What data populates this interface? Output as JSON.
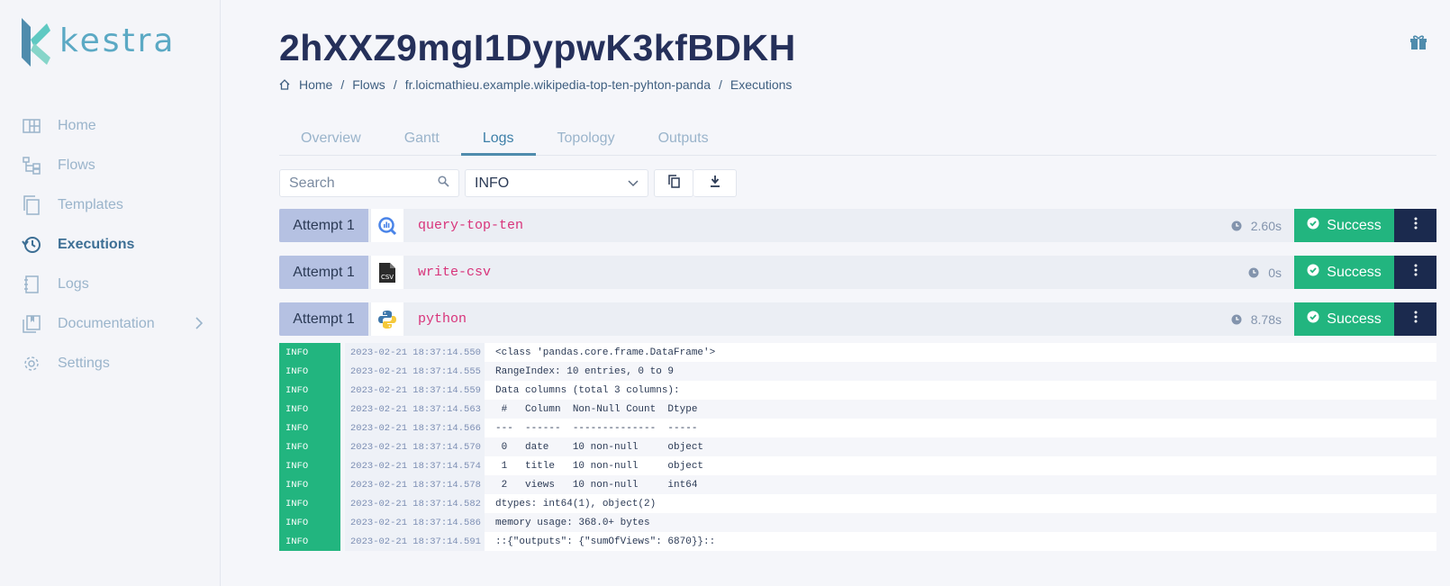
{
  "app": {
    "logo_text": "kestra"
  },
  "sidebar": {
    "items": [
      {
        "label": "Home",
        "icon": "home-grid-icon"
      },
      {
        "label": "Flows",
        "icon": "flows-tree-icon"
      },
      {
        "label": "Templates",
        "icon": "templates-copy-icon"
      },
      {
        "label": "Executions",
        "icon": "history-clock-icon",
        "active": true
      },
      {
        "label": "Logs",
        "icon": "notebook-icon"
      },
      {
        "label": "Documentation",
        "icon": "book-icon",
        "has_children": true
      },
      {
        "label": "Settings",
        "icon": "gear-icon"
      }
    ]
  },
  "header": {
    "title": "2hXXZ9mgI1DypwK3kfBDKH",
    "breadcrumb": [
      "Home",
      "Flows",
      "fr.loicmathieu.example.wikipedia-top-ten-pyhton-panda",
      "Executions"
    ]
  },
  "tabs": [
    "Overview",
    "Gantt",
    "Logs",
    "Topology",
    "Outputs"
  ],
  "active_tab": "Logs",
  "toolbar": {
    "search_placeholder": "Search",
    "level_value": "INFO"
  },
  "attempts": [
    {
      "label": "Attempt 1",
      "task": "query-top-ten",
      "duration": "2.60s",
      "status": "Success",
      "icon": "bigquery-icon"
    },
    {
      "label": "Attempt 1",
      "task": "write-csv",
      "duration": "0s",
      "status": "Success",
      "icon": "csv-file-icon"
    },
    {
      "label": "Attempt 1",
      "task": "python",
      "duration": "8.78s",
      "status": "Success",
      "icon": "python-icon"
    }
  ],
  "logs": [
    {
      "level": "INFO",
      "date": "2023-02-21 18:37:14.550",
      "message": "<class 'pandas.core.frame.DataFrame'>"
    },
    {
      "level": "INFO",
      "date": "2023-02-21 18:37:14.555",
      "message": "RangeIndex: 10 entries, 0 to 9"
    },
    {
      "level": "INFO",
      "date": "2023-02-21 18:37:14.559",
      "message": "Data columns (total 3 columns):"
    },
    {
      "level": "INFO",
      "date": "2023-02-21 18:37:14.563",
      "message": " #   Column  Non-Null Count  Dtype "
    },
    {
      "level": "INFO",
      "date": "2023-02-21 18:37:14.566",
      "message": "---  ------  --------------  ----- "
    },
    {
      "level": "INFO",
      "date": "2023-02-21 18:37:14.570",
      "message": " 0   date    10 non-null     object"
    },
    {
      "level": "INFO",
      "date": "2023-02-21 18:37:14.574",
      "message": " 1   title   10 non-null     object"
    },
    {
      "level": "INFO",
      "date": "2023-02-21 18:37:14.578",
      "message": " 2   views   10 non-null     int64 "
    },
    {
      "level": "INFO",
      "date": "2023-02-21 18:37:14.582",
      "message": "dtypes: int64(1), object(2)"
    },
    {
      "level": "INFO",
      "date": "2023-02-21 18:37:14.586",
      "message": "memory usage: 368.0+ bytes"
    },
    {
      "level": "INFO",
      "date": "2023-02-21 18:37:14.591",
      "message": "::{\"outputs\": {\"sumOfViews\": 6870}}::"
    }
  ],
  "colors": {
    "success": "#22b57f",
    "attempt_bg": "#b5c1e2",
    "menu_bg": "#1b2a4e",
    "task_name": "#d8337a",
    "logo": "#5ba9c4"
  }
}
